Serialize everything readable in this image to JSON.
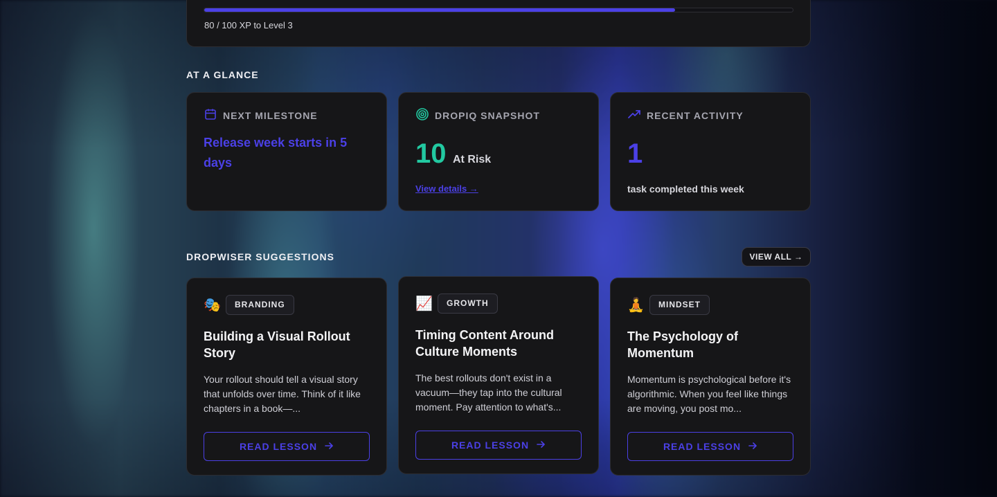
{
  "xp": {
    "progress_fraction": 0.8,
    "label": "80 / 100 XP to Level 3"
  },
  "glance": {
    "section_title": "AT A GLANCE",
    "milestone": {
      "heading": "NEXT MILESTONE",
      "text": "Release week starts in 5 days",
      "icon": "calendar-icon"
    },
    "snapshot": {
      "heading": "DROPIQ SNAPSHOT",
      "value": "10",
      "value_label": "At Risk",
      "link": "View details →",
      "icon": "target-icon"
    },
    "activity": {
      "heading": "RECENT ACTIVITY",
      "value": "1",
      "subtext": "task completed this week",
      "icon": "trending-up-icon"
    }
  },
  "suggestions": {
    "section_title": "DROPWISER SUGGESTIONS",
    "view_all_label": "VIEW ALL →",
    "items": [
      {
        "emoji": "🎭",
        "tag": "BRANDING",
        "title": "Building a Visual Rollout Story",
        "desc": "Your rollout should tell a visual story that unfolds over time. Think of it like chapters in a book—...",
        "button": "READ LESSON"
      },
      {
        "emoji": "📈",
        "tag": "GROWTH",
        "title": "Timing Content Around Culture Moments",
        "desc": "The best rollouts don't exist in a vacuum—they tap into the cultural moment. Pay attention to what's...",
        "button": "READ LESSON"
      },
      {
        "emoji": "🧘",
        "tag": "MINDSET",
        "title": "The Psychology of Momentum",
        "desc": "Momentum is psychological before it's algorithmic. When you feel like things are moving, you post mo...",
        "button": "READ LESSON"
      }
    ]
  },
  "colors": {
    "accent": "#4b40e6",
    "green": "#22c9a1",
    "card_bg": "#161618"
  }
}
